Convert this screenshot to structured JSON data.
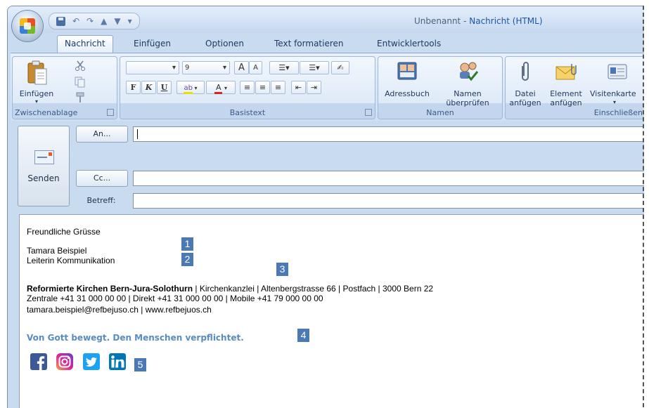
{
  "titlebar": {
    "doc_name": "Unbenannt - ",
    "app_name": "Nachricht (HTML)",
    "qat_dropdown": "▾"
  },
  "tabs": [
    {
      "label": "Nachricht",
      "active": true
    },
    {
      "label": "Einfügen"
    },
    {
      "label": "Optionen"
    },
    {
      "label": "Text formatieren"
    },
    {
      "label": "Entwicklertools"
    }
  ],
  "ribbon": {
    "clipboard": {
      "paste": "Einfügen",
      "paste_arrow": "▾",
      "group": "Zwischenablage"
    },
    "basictext": {
      "font_size": "9",
      "grow": "A",
      "shrink": "A",
      "bold": "F",
      "italic": "K",
      "underline": "U",
      "font_color": "A",
      "group": "Basistext"
    },
    "names": {
      "addressbook": "Adressbuch",
      "check_names_1": "Namen",
      "check_names_2": "überprüfen",
      "group": "Namen"
    },
    "include": {
      "attach_file_1": "Datei",
      "attach_file_2": "anfügen",
      "attach_item_1": "Element",
      "attach_item_2": "anfügen",
      "business_card": "Visitenkarte",
      "business_card_arrow": "▾",
      "group": "Einschließen"
    }
  },
  "compose": {
    "send": "Senden",
    "to": "An...",
    "cc": "Cc...",
    "subject": "Betreff:"
  },
  "signature": {
    "greeting": "Freundliche Grüsse",
    "name": "Tamara Beispiel",
    "role": "Leiterin Kommunikation",
    "org": "Reformierte Kirchen Bern-Jura-Solothurn",
    "address_rest": " | Kirchenkanzlei | Altenbergstrasse 66 | Postfach | 3000 Bern 22",
    "phones": "Zentrale +41 31 000 00 00 | Direkt +41 31 000 00 00 | Mobile +41 79 000 00 00",
    "contact": "tamara.beispiel@refbejuso.ch | www.refbejuos.ch",
    "slogan": "Von Gott bewegt. Den Menschen verpflichtet."
  },
  "markers": [
    "1",
    "2",
    "3",
    "4",
    "5"
  ],
  "colors": {
    "accent_blue": "#4a79b3",
    "slogan_blue": "#5a8bc1",
    "facebook": "#3b5998",
    "twitter": "#1da1f2",
    "linkedin": "#0077b5",
    "instagram": "#c13584"
  }
}
